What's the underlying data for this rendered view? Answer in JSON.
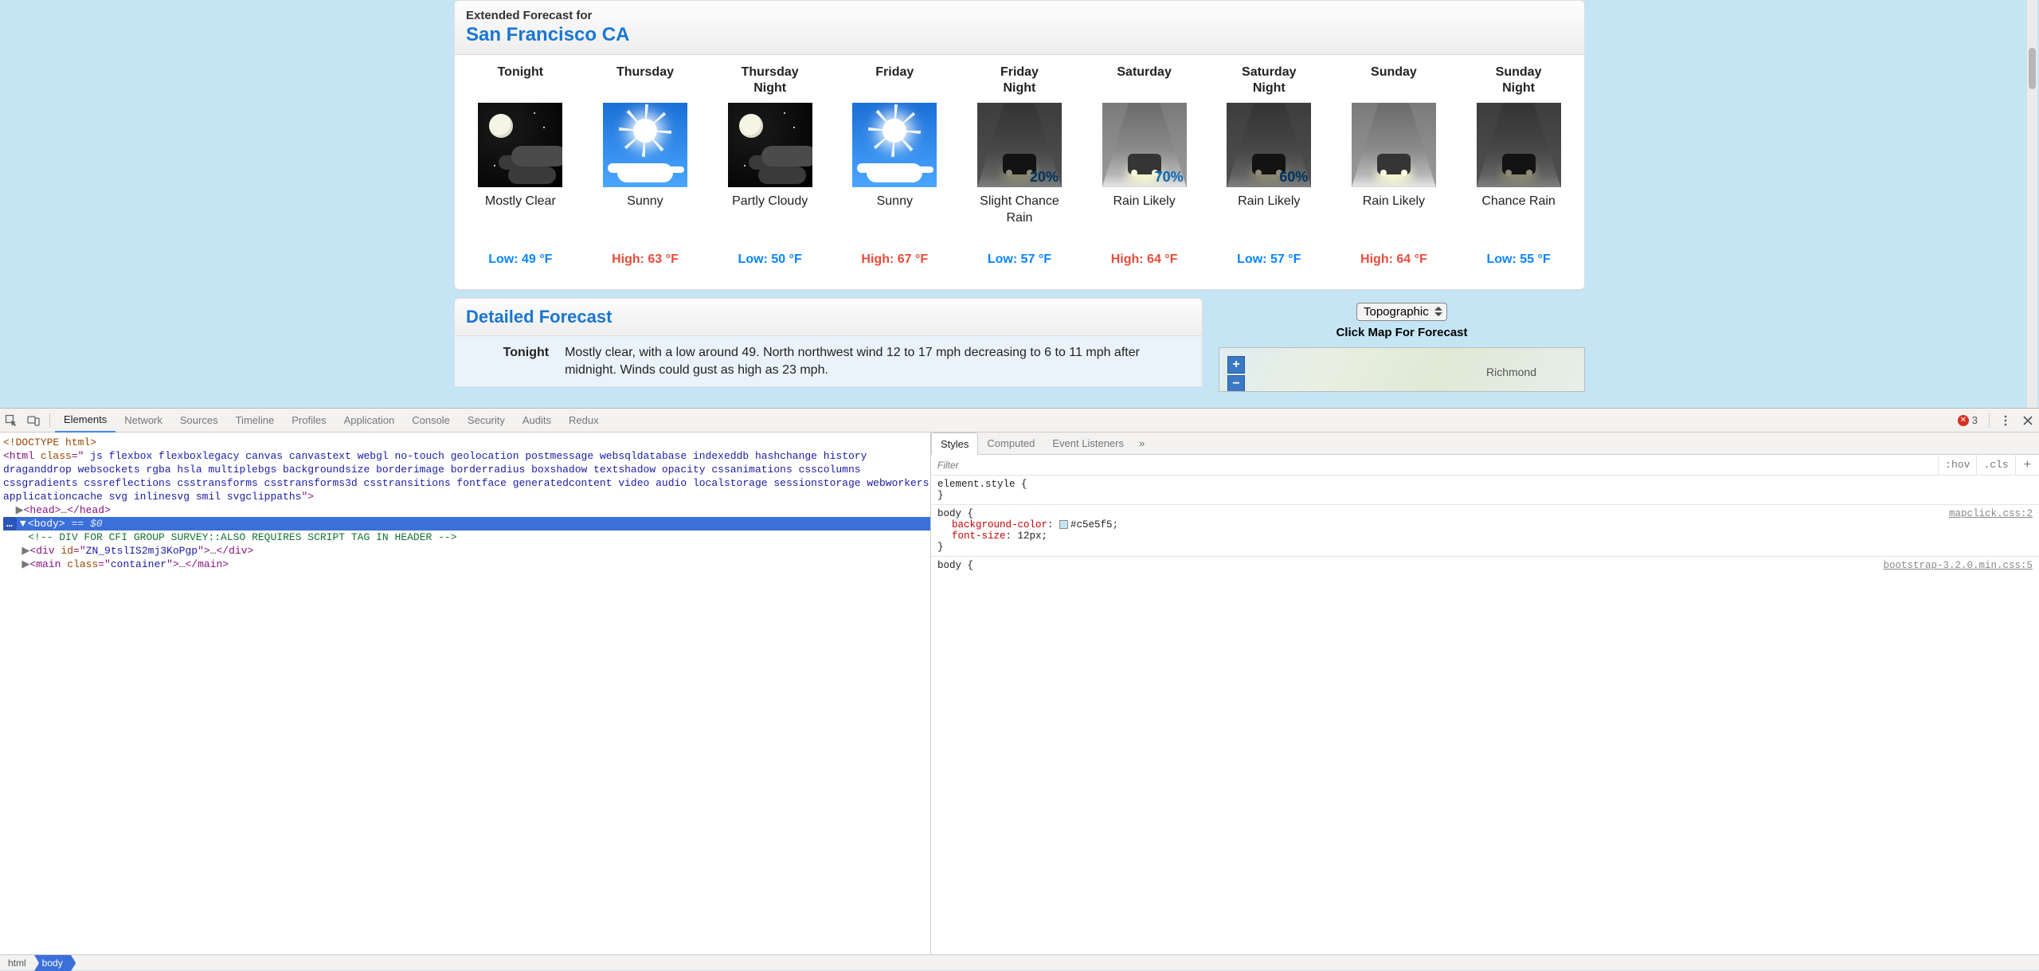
{
  "forecast_panel": {
    "prefix": "Extended Forecast for",
    "location": "San Francisco CA",
    "days": [
      {
        "title": "Tonight",
        "cond": "Mostly Clear",
        "templabel": "Low: 49 °F",
        "type": "lo",
        "icon": "night-clear",
        "pct": ""
      },
      {
        "title": "Thursday",
        "cond": "Sunny",
        "templabel": "High: 63 °F",
        "type": "hi",
        "icon": "sunny",
        "pct": ""
      },
      {
        "title": "Thursday\nNight",
        "cond": "Partly Cloudy",
        "templabel": "Low: 50 °F",
        "type": "lo",
        "icon": "night-pc",
        "pct": ""
      },
      {
        "title": "Friday",
        "cond": "Sunny",
        "templabel": "High: 67 °F",
        "type": "hi",
        "icon": "sunny",
        "pct": ""
      },
      {
        "title": "Friday\nNight",
        "cond": "Slight Chance\nRain",
        "templabel": "Low: 57 °F",
        "type": "lo",
        "icon": "rain-nite",
        "pct": "20%"
      },
      {
        "title": "Saturday",
        "cond": "Rain Likely",
        "templabel": "High: 64 °F",
        "type": "hi",
        "icon": "rain-day",
        "pct": "70%"
      },
      {
        "title": "Saturday\nNight",
        "cond": "Rain Likely",
        "templabel": "Low: 57 °F",
        "type": "lo",
        "icon": "rain-nite",
        "pct": "60%"
      },
      {
        "title": "Sunday",
        "cond": "Rain Likely",
        "templabel": "High: 64 °F",
        "type": "hi",
        "icon": "rain-day",
        "pct": ""
      },
      {
        "title": "Sunday\nNight",
        "cond": "Chance Rain",
        "templabel": "Low: 55 °F",
        "type": "lo",
        "icon": "rain-nite",
        "pct": ""
      }
    ]
  },
  "detailed": {
    "heading": "Detailed Forecast",
    "row_label": "Tonight",
    "row_text": "Mostly clear, with a low around 49. North northwest wind 12 to 17 mph decreasing to 6 to 11 mph after midnight. Winds could gust as high as 23 mph."
  },
  "sidebar": {
    "select_value": "Topographic",
    "caption": "Click Map For Forecast",
    "zoom_in": "+",
    "zoom_out": "−",
    "map_label_city": "Richmond"
  },
  "devtools": {
    "tabs": [
      "Elements",
      "Network",
      "Sources",
      "Timeline",
      "Profiles",
      "Application",
      "Console",
      "Security",
      "Audits",
      "Redux"
    ],
    "active_tab": 0,
    "error_count": "3",
    "styles_tabs": [
      "Styles",
      "Computed",
      "Event Listeners"
    ],
    "filter_placeholder": "Filter",
    "hov": ":hov",
    "cls": ".cls",
    "dom": {
      "l0": "<!DOCTYPE html>",
      "l1_open": "<html ",
      "l1_attr": "class",
      "l1_val": " js flexbox flexboxlegacy canvas canvastext webgl no-touch geolocation postmessage websqldatabase indexeddb hashchange history draganddrop websockets rgba hsla multiplebgs backgroundsize borderimage borderradius boxshadow textshadow opacity cssanimations csscolumns cssgradients cssreflections csstransforms csstransforms3d csstransitions fontface generatedcontent video audio localstorage sessionstorage webworkers applicationcache svg inlinesvg smil svgclippaths",
      "l1_close": ">",
      "l2": "<head>…</head>",
      "l3_open": "<body>",
      "l3_badge": "== $0",
      "l4": "<!-- DIV FOR CFI GROUP SURVEY::ALSO REQUIRES SCRIPT TAG IN HEADER -->",
      "l5_a": "<div id=\"",
      "l5_id": "ZN_9tslIS2mj3KoPgp",
      "l5_b": "\">…</div>",
      "l6_a": "<main class=\"",
      "l6_cls": "container",
      "l6_b": "\">…</main>"
    },
    "styles_pane": {
      "r0_sel": "element.style",
      "r1_sel": "body",
      "r1_src": "mapclick.css:2",
      "r1_p1n": "background-color",
      "r1_p1v": "#c5e5f5",
      "r1_p2n": "font-size",
      "r1_p2v": "12px",
      "r2_sel": "body",
      "r2_src": "bootstrap-3.2.0.min.css:5"
    },
    "crumbs": [
      "html",
      "body"
    ]
  }
}
